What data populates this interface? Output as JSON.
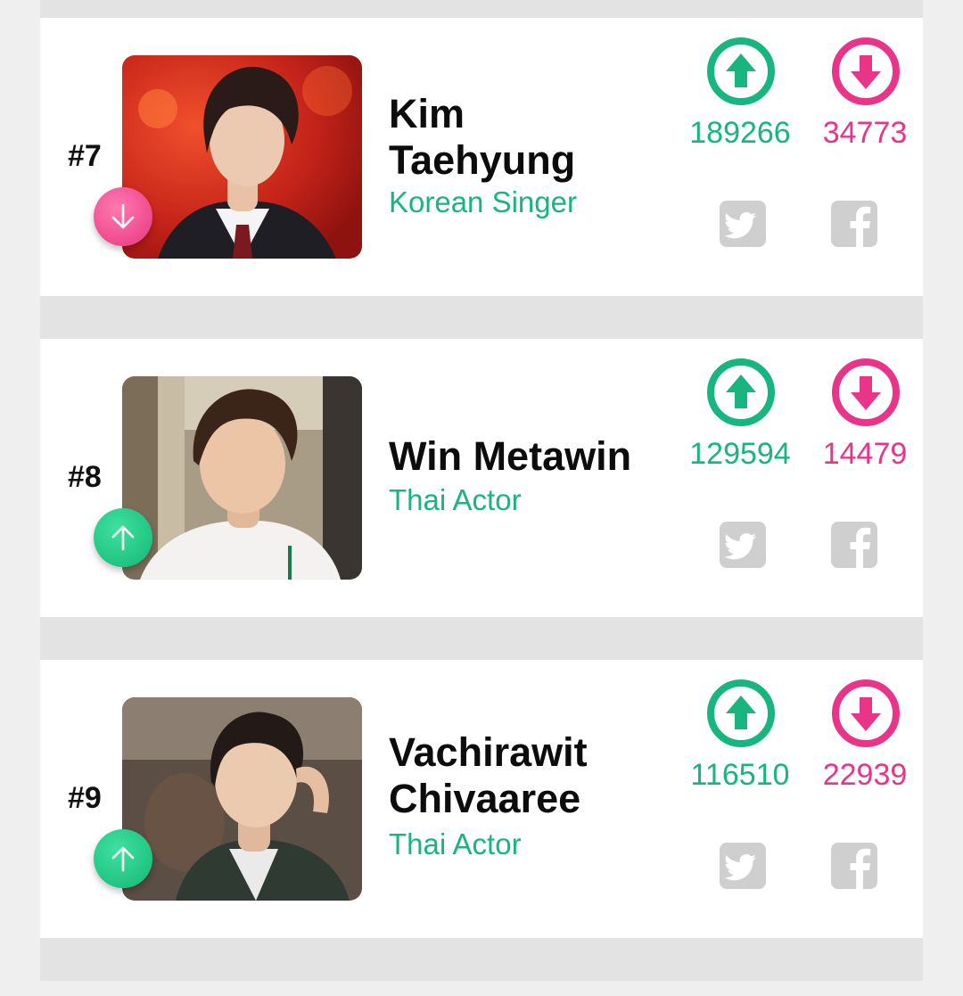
{
  "cards": [
    {
      "rank": "#7",
      "name": "Kim Taehyung",
      "name_lines": [
        "Kim",
        "Taehyung"
      ],
      "role": "Korean Singer",
      "trend": "down",
      "up_votes": "189266",
      "down_votes": "34773"
    },
    {
      "rank": "#8",
      "name": "Win Metawin",
      "name_lines": [
        "Win Metawin"
      ],
      "role": "Thai Actor",
      "trend": "up",
      "up_votes": "129594",
      "down_votes": "14479"
    },
    {
      "rank": "#9",
      "name": "Vachirawit Chivaaree",
      "name_lines": [
        "Vachirawit",
        "Chivaaree"
      ],
      "role": "Thai Actor",
      "trend": "up",
      "up_votes": "116510",
      "down_votes": "22939"
    }
  ],
  "icons": {
    "upvote": "upvote-icon",
    "downvote": "downvote-icon",
    "twitter": "twitter-icon",
    "facebook": "facebook-icon"
  },
  "colors": {
    "green": "#19b57f",
    "pink": "#e8358a",
    "social_gray": "#cfcfcf"
  }
}
